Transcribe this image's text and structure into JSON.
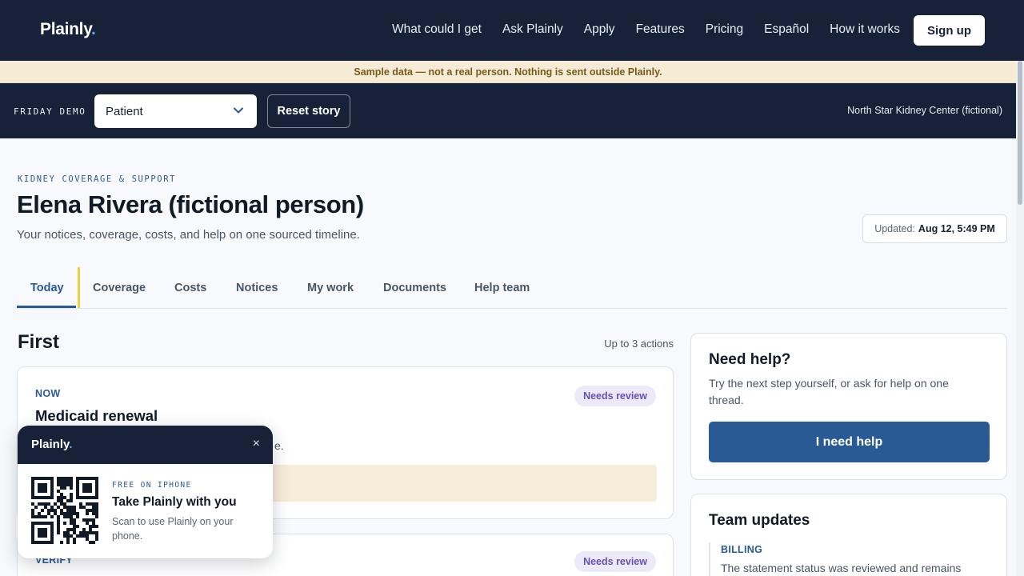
{
  "nav": {
    "brand": "Plainly",
    "brand_dot": ".",
    "links": [
      "What could I get",
      "Ask Plainly",
      "Apply",
      "Features",
      "Pricing",
      "Español",
      "How it works"
    ],
    "signup": "Sign up"
  },
  "banner": {
    "text": "Sample data — not a real person. Nothing is sent outside Plainly."
  },
  "demo": {
    "label": "FRIDAY DEMO",
    "role_selected": "Patient",
    "reset": "Reset story",
    "center": "North Star Kidney Center (fictional)"
  },
  "header": {
    "eyebrow": "KIDNEY COVERAGE & SUPPORT",
    "title": "Elena Rivera (fictional person)",
    "subtitle": "Your notices, coverage, costs, and help on one sourced timeline.",
    "updated_label": "Updated:",
    "updated_value": "Aug 12, 5:49 PM"
  },
  "tabs": [
    "Today",
    "Coverage",
    "Costs",
    "Notices",
    "My work",
    "Documents",
    "Help team"
  ],
  "first": {
    "heading": "First",
    "note": "Up to 3 actions",
    "cards": [
      {
        "eyebrow": "NOW",
        "title": "Medicaid renewal",
        "body_tail": "e.",
        "badge": "Needs review"
      },
      {
        "eyebrow": "VERIFY",
        "badge": "Needs review"
      }
    ]
  },
  "help": {
    "title": "Need help?",
    "text": "Try the next step yourself, or ask for help on one thread.",
    "button": "I need help"
  },
  "team": {
    "title": "Team updates",
    "label": "BILLING",
    "text": "The statement status was reviewed and remains"
  },
  "qr": {
    "brand": "Plainly",
    "brand_dot": ".",
    "close": "×",
    "eyebrow": "FREE ON IPHONE",
    "title": "Take Plainly with you",
    "text": "Scan to use Plainly on your phone."
  },
  "colors": {
    "navy": "#172238",
    "accent": "#2a5a96",
    "badge_bg": "#ece9f8",
    "badge_fg": "#6b4fb8",
    "tab_marker": "#f2cf3c"
  }
}
